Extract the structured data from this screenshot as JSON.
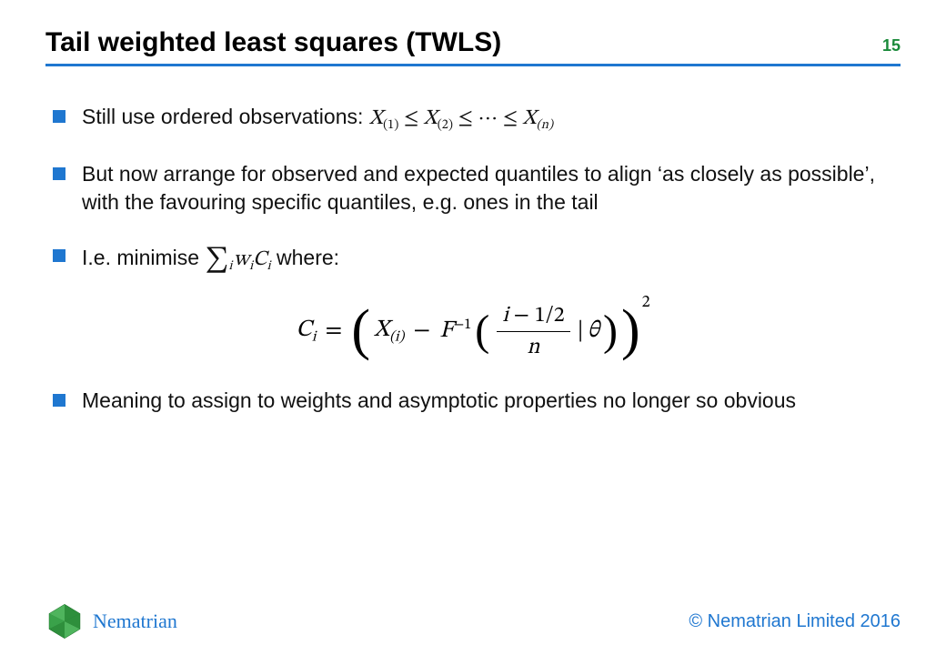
{
  "header": {
    "title": "Tail weighted least squares (TWLS)",
    "page_number": "15"
  },
  "bullets": [
    {
      "prefix": "Still use ordered observations: ",
      "math": "X_{(1)} \\le X_{(2)} \\le \\cdots \\le X_{(n)}"
    },
    {
      "text": "But now arrange for observed and expected quantiles to align ‘as closely as possible’, with the favouring specific quantiles, e.g. ones in the tail"
    },
    {
      "prefix": "I.e. minimise ",
      "math_inline": "\\sum_{i} w_i C_i",
      "suffix": " where:"
    },
    {
      "text": "Meaning to assign to weights and asymptotic properties no longer so obvious"
    }
  ],
  "equation": {
    "latex": "C_i = \\left( X_{(i)} - F^{-1}\\left( \\frac{i - 1/2}{n} \\,|\\, \\theta \\right) \\right)^{2}"
  },
  "footer": {
    "brand": "Nematrian",
    "copyright": "© Nematrian Limited 2016"
  },
  "colors": {
    "accent": "#1f77d0",
    "page_num": "#1a8a3a"
  },
  "chart_data": null
}
